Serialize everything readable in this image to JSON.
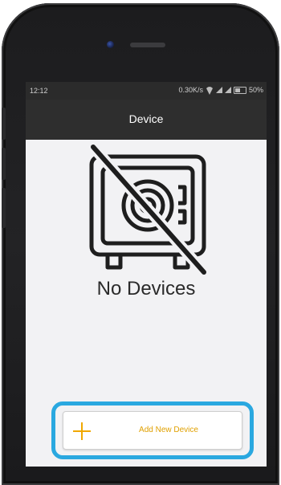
{
  "status_bar": {
    "time": "12:12",
    "speed": "0.30K/s",
    "battery_percent": "50%",
    "battery_level": 0.5
  },
  "nav": {
    "title": "Device"
  },
  "empty_state": {
    "icon": "no-safe-icon",
    "message": "No Devices"
  },
  "add_button": {
    "icon": "plus-icon",
    "label": "Add New Device"
  },
  "colors": {
    "accent": "#f0a800",
    "highlight": "#2aa8e0",
    "nav_bg": "#2e2e2e"
  }
}
